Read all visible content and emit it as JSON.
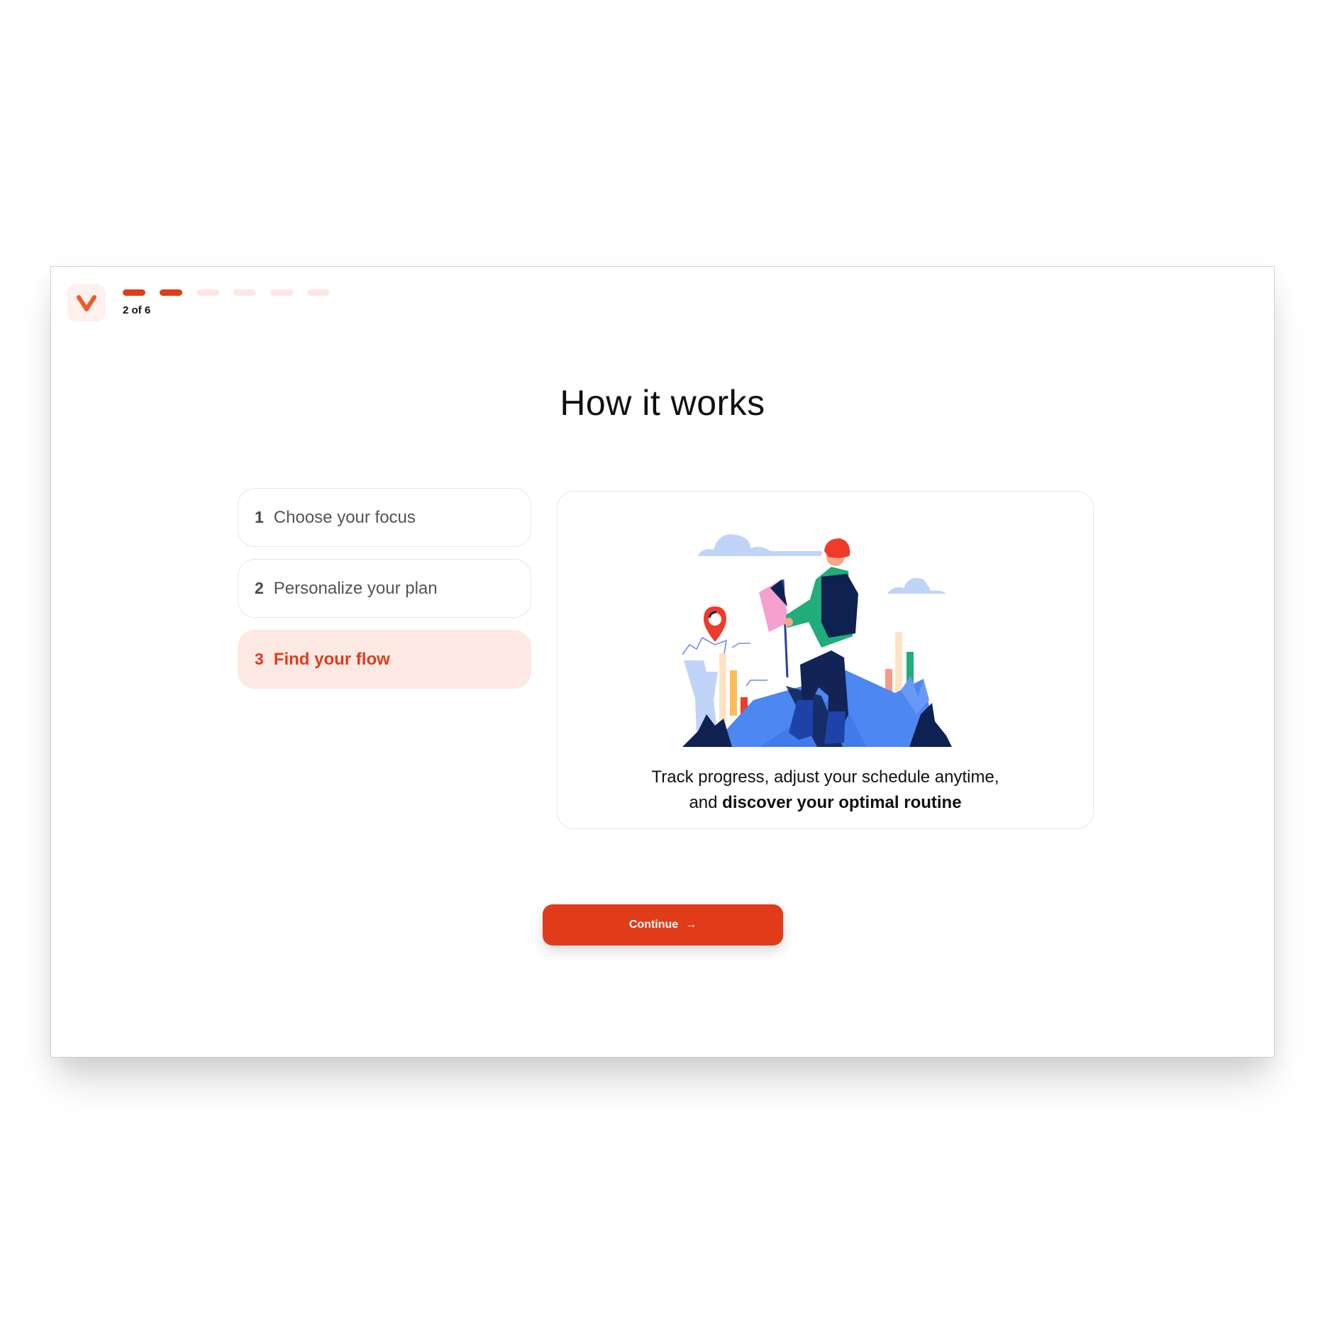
{
  "header": {
    "logo_icon": "v-logo-icon",
    "progress": {
      "current": 2,
      "total": 6,
      "label": "2 of 6"
    }
  },
  "main": {
    "title": "How it works",
    "steps": [
      {
        "number": "1",
        "label": "Choose your focus",
        "active": false
      },
      {
        "number": "2",
        "label": "Personalize your plan",
        "active": false
      },
      {
        "number": "3",
        "label": "Find your flow",
        "active": true
      }
    ],
    "panel": {
      "illustration": "hiker-on-summit-illustration",
      "caption_regular": "Track progress, adjust your schedule anytime,",
      "caption_line2_prefix": "and ",
      "caption_bold": "discover your optimal routine"
    },
    "continue_button": {
      "label": "Continue",
      "icon": "arrow-right-icon",
      "glyph": "→"
    }
  },
  "colors": {
    "accent": "#E03C1A",
    "accent_light": "#FDE9E4",
    "logo_bg": "#FEF1EE",
    "text": "#111111",
    "muted_text": "#57534E"
  }
}
